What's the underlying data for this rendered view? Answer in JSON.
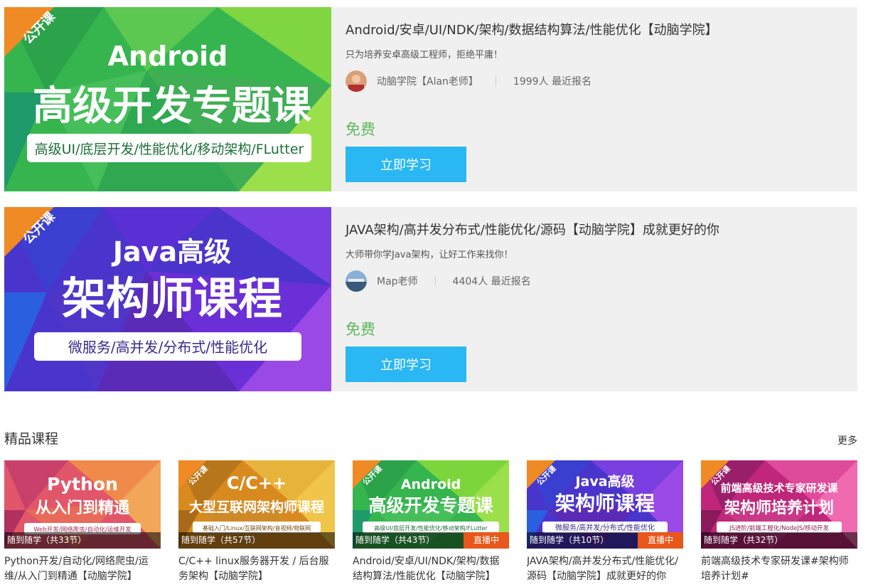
{
  "featured": [
    {
      "banner": {
        "badge": "公开课",
        "line1": "Android",
        "line2": "高级开发专题课",
        "tagline": "高级UI/底层开发/性能优化/移动架构/FLutter",
        "colors": [
          "#2bb24c",
          "#7cd63b",
          "#1f9a6b",
          "#58c85a",
          "#a5e04a"
        ]
      },
      "title": "Android/安卓/UI/NDK/架构/数据结构算法/性能优化【动脑学院】",
      "subtitle": "只为培养安卓高级工程师，拒绝平庸！",
      "teacher": "动脑学院【Alan老师】",
      "enroll": "1999人 最近报名",
      "price": "免费",
      "button": "立即学习"
    },
    {
      "banner": {
        "badge": "公开课",
        "line1": "Java高级",
        "line2": "架构师课程",
        "tagline": "微服务/高并发/分布式/性能优化",
        "colors": [
          "#3b3fcf",
          "#6a2fd6",
          "#8f3fe0",
          "#2a5fe0",
          "#5b2bb8"
        ]
      },
      "title": "JAVA架构/高并发分布式/性能优化/源码【动脑学院】成就更好的你",
      "subtitle": "大师带你学Java架构，让好工作来找你！",
      "teacher": "Map老师",
      "enroll": "4404人 最近报名",
      "price": "免费",
      "button": "立即学习"
    }
  ],
  "section": {
    "title": "精品课程",
    "more": "更多"
  },
  "courses": [
    {
      "badge": "",
      "line1": "Python",
      "line2": "从入门到精通",
      "tagline": "Web开发/网络爬虫/自动化/运维开发",
      "ribbon": "随到随学（共33节）",
      "live": "",
      "name": "Python开发/自动化/网络爬虫/运维/从入门到精通【动脑学院】",
      "colors": [
        "#e2566a",
        "#f08a4b",
        "#c9406a",
        "#f2a65a"
      ]
    },
    {
      "badge": "公开课",
      "line1": "C/C++",
      "line2": "大型互联网架构师课程",
      "tagline": "基础入门/Linux/互联网架构/音视频/物联网",
      "ribbon": "随到随学（共57节）",
      "live": "",
      "name": "C/C++ linux服务器开发 / 后台服务架构【动脑学院】",
      "colors": [
        "#d98a1f",
        "#e8b33a",
        "#b8761a",
        "#f0c54a"
      ]
    },
    {
      "badge": "公开课",
      "line1": "Android",
      "line2": "高级开发专题课",
      "tagline": "高级UI/底层开发/性能优化/移动架构/FLutter",
      "ribbon": "随到随学（共43节）",
      "live": "直播中",
      "name": "Android/安卓/UI/NDK/架构/数据结构算法/性能优化【动脑学院】",
      "colors": [
        "#2bb24c",
        "#7cd63b",
        "#1f9a6b",
        "#58c85a"
      ]
    },
    {
      "badge": "公开课",
      "line1": "Java高级",
      "line2": "架构师课程",
      "tagline": "微服务/高并发/分布式/性能优化",
      "ribbon": "随到随学（共10节）",
      "live": "直播中",
      "name": "JAVA架构/高并发分布式/性能优化/源码【动脑学院】成就更好的你",
      "colors": [
        "#3b3fcf",
        "#6a2fd6",
        "#8f3fe0",
        "#2a5fe0"
      ]
    },
    {
      "badge": "公开课",
      "line1": "前端高级技术专家研发课",
      "line2": "架构师培养计划",
      "tagline": "JS进阶/前端工程化/NodeJS/移动开发",
      "ribbon": "随到随学（共32节）",
      "live": "",
      "name": "前端高级技术专家研发课#架构师培养计划#",
      "colors": [
        "#c0267a",
        "#e04a9a",
        "#9a1f6a",
        "#f06ab0"
      ]
    }
  ]
}
